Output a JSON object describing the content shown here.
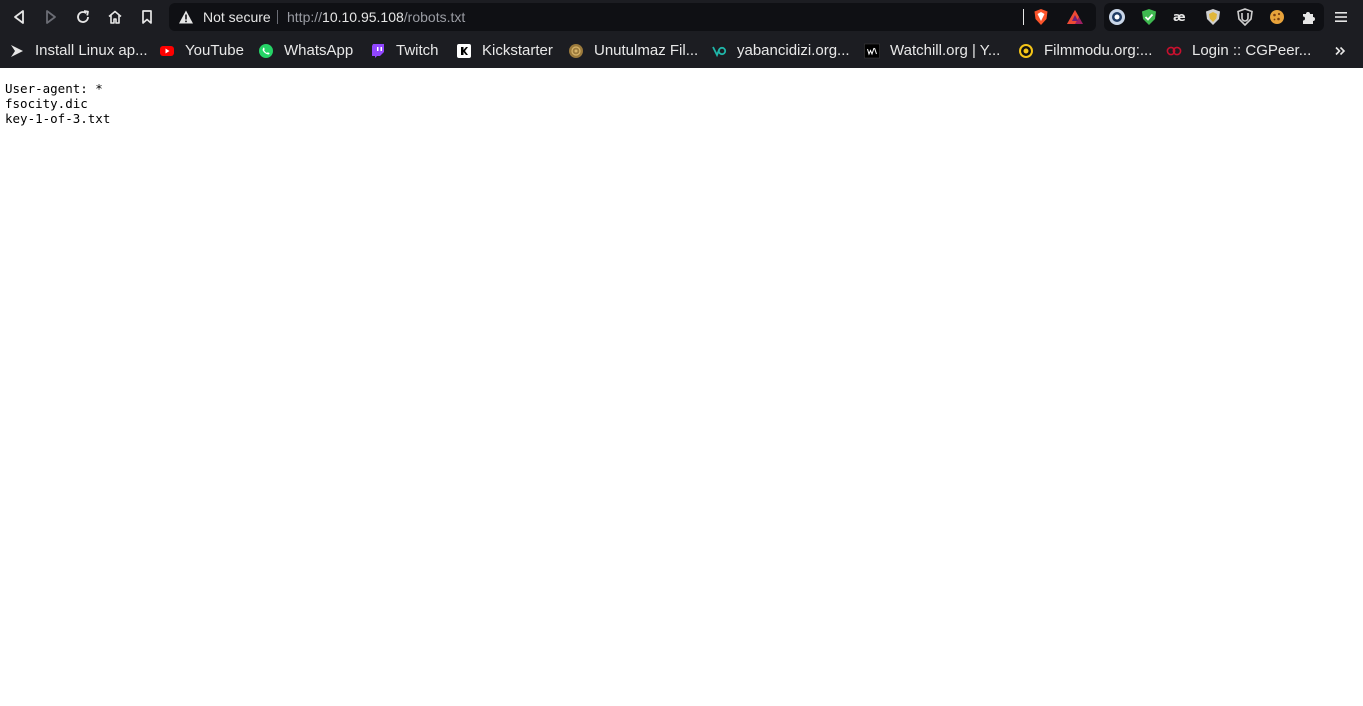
{
  "toolbar": {
    "icons": [
      "back-icon",
      "forward-icon",
      "reload-icon",
      "home-icon",
      "bookmark-icon"
    ]
  },
  "address_bar": {
    "security_label": "Not secure",
    "url_scheme": "http://",
    "url_host": "10.10.95.108",
    "url_path": "/robots.txt",
    "security_icon": "warning-triangle-icon"
  },
  "extensions": [
    "extension-ring-icon",
    "extension-shield-check-icon",
    "extension-ae-icon",
    "extension-badge-icon",
    "extension-ublock-icon",
    "extension-cookie-icon",
    "puzzle-icon"
  ],
  "bookmarks": [
    {
      "label": "Install Linux ap...",
      "icon": "arrow-bookmark-icon"
    },
    {
      "label": "YouTube",
      "icon": "youtube-icon"
    },
    {
      "label": "WhatsApp",
      "icon": "whatsapp-icon"
    },
    {
      "label": "Twitch",
      "icon": "twitch-icon"
    },
    {
      "label": "Kickstarter",
      "icon": "kickstarter-icon"
    },
    {
      "label": "Unutulmaz Fil...",
      "icon": "globe-bookmark-icon"
    },
    {
      "label": "yabancidizi.org...",
      "icon": "yabancidizi-icon"
    },
    {
      "label": "Watchill.org | Y...",
      "icon": "watchill-icon"
    },
    {
      "label": "Filmmodu.org:...",
      "icon": "filmmodu-icon"
    },
    {
      "label": "Login :: CGPeer...",
      "icon": "cgpeers-icon"
    }
  ],
  "page": {
    "lines": [
      "User-agent: *",
      "fsocity.dic",
      "key-1-of-3.txt"
    ]
  },
  "colors": {
    "chrome_bg": "#1c1d22",
    "field_bg": "#0f1014",
    "text": "#e8e8e8",
    "url_dim": "#9a9ca3",
    "brave_orange": "#fb542b",
    "page_bg": "#ffffff"
  }
}
